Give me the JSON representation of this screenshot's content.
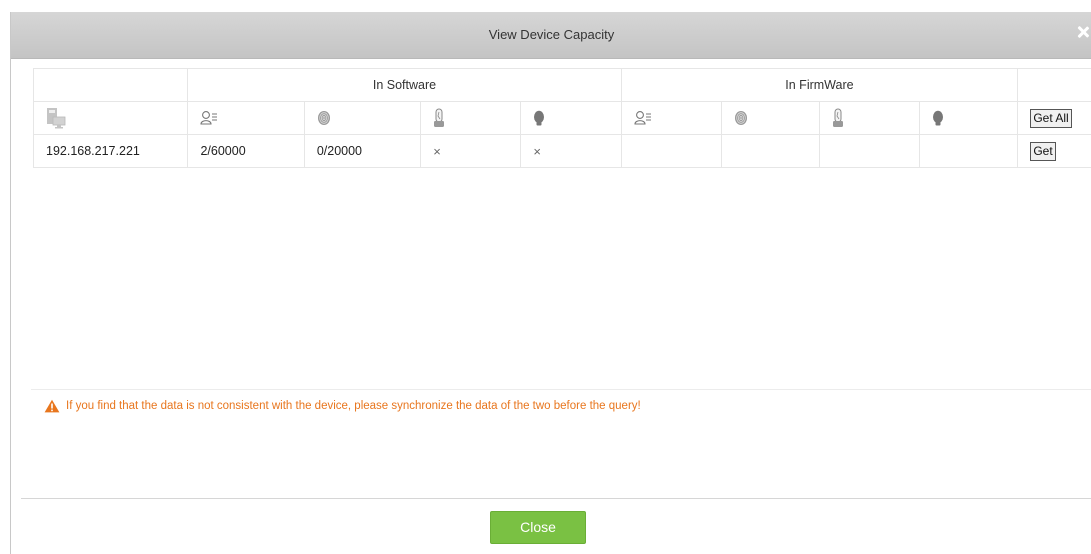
{
  "dialog": {
    "title": "View Device Capacity"
  },
  "table": {
    "groups": {
      "software": "In Software",
      "firmware": "In FirmWare"
    },
    "icons": [
      "device-icon",
      "user-card-icon",
      "fingerprint-icon",
      "finger-vein-icon",
      "face-icon"
    ],
    "get_all_label": "Get All",
    "rows": [
      {
        "device": "192.168.217.221",
        "sw_users": "2/60000",
        "sw_fingerprints": "0/20000",
        "sw_finger_vein": "×",
        "sw_face": "×",
        "fw_users": "",
        "fw_fingerprints": "",
        "fw_finger_vein": "",
        "fw_face": "",
        "get_label": "Get"
      }
    ]
  },
  "notice": {
    "text": "If you find that the data is not consistent with the device, please synchronize the data of the two before the query!",
    "color": "#e8761e"
  },
  "footer": {
    "close_label": "Close",
    "close_color": "#7ac143"
  }
}
